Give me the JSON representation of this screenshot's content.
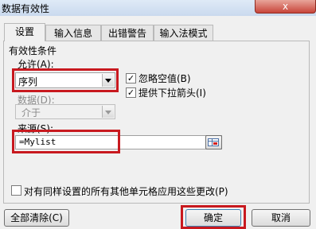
{
  "window": {
    "title": "数据有效性",
    "close_glyph": "x"
  },
  "tabs": [
    {
      "label": "设置"
    },
    {
      "label": "输入信息"
    },
    {
      "label": "出错警告"
    },
    {
      "label": "输入法模式"
    }
  ],
  "criteria": {
    "group_label": "有效性条件",
    "allow_label": "允许(A):",
    "allow_value": "序列",
    "ignore_blank_label": "忽略空值(B)",
    "ignore_blank_checked": true,
    "dropdown_label": "提供下拉箭头(I)",
    "dropdown_checked": true,
    "data_label": "数据(D):",
    "data_value": "介于",
    "source_label": "来源(S):",
    "source_value": "=Mylist"
  },
  "apply_all_label": "对有同样设置的所有其他单元格应用这些更改(P)",
  "apply_all_checked": false,
  "buttons": {
    "clear_all": "全部清除(C)",
    "ok": "确定",
    "cancel": "取消"
  },
  "colors": {
    "highlight_red": "#c8191f"
  }
}
